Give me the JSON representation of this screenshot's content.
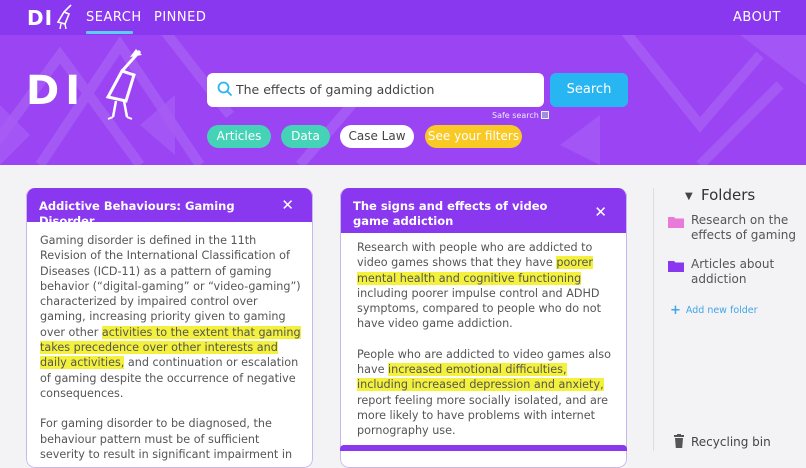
{
  "brand": {
    "logo_small": "DI",
    "logo_big": "DI"
  },
  "nav": {
    "search": "SEARCH",
    "pinned": "PINNED",
    "about": "ABOUT"
  },
  "search": {
    "query": "The effects of gaming addiction",
    "button": "Search",
    "safe_search": "Safe search"
  },
  "filters": {
    "articles": "Articles",
    "data": "Data",
    "case_law": "Case Law",
    "see_filters": "See your filters"
  },
  "cards": [
    {
      "title": "Addictive Behaviours: Gaming Disorder",
      "p1_a": "Gaming disorder is defined in the 11th Revision of the International Classification of Diseases (ICD-11) as a pattern of gaming behavior (“digital-gaming” or “video-gaming”) characterized by impaired control over gaming, increasing priority given to gaming over other ",
      "p1_hl": "activities to the extent that gaming takes precedence over other interests and daily activities,",
      "p1_b": " and continuation or escalation of gaming despite the occurrence of negative consequences.",
      "p2": "For gaming disorder to be diagnosed, the behaviour pattern must be of sufficient severity to result in significant impairment in"
    },
    {
      "title": "The signs and effects of video game addiction",
      "p1_a": "Research with people who are addicted to video games shows that they have ",
      "p1_hl": "poorer mental health and cognitive functioning",
      "p1_b": " including poorer impulse control and ADHD symptoms, compared to people who do not have video game addiction.",
      "p2_a": "People who are addicted to video games also have ",
      "p2_hl": "increased emotional difficulties, including increased depression and anxiety,",
      "p2_b": " report feeling more socially isolated, and are more likely to have problems with internet pornography use."
    }
  ],
  "folders": {
    "title": "Folders",
    "items": [
      {
        "label": "Research on the effects of gaming",
        "color": "#e97ad9"
      },
      {
        "label": "Articles about addiction",
        "color": "#8a37f0"
      }
    ],
    "add": "Add new folder",
    "recycle": "Recycling bin"
  },
  "colors": {
    "purple": "#8a37f0",
    "hero": "#9a44f3",
    "teal": "#44d3b6",
    "blue": "#28b6f2",
    "yellow": "#f9c926",
    "highlight": "#f4f13c"
  }
}
